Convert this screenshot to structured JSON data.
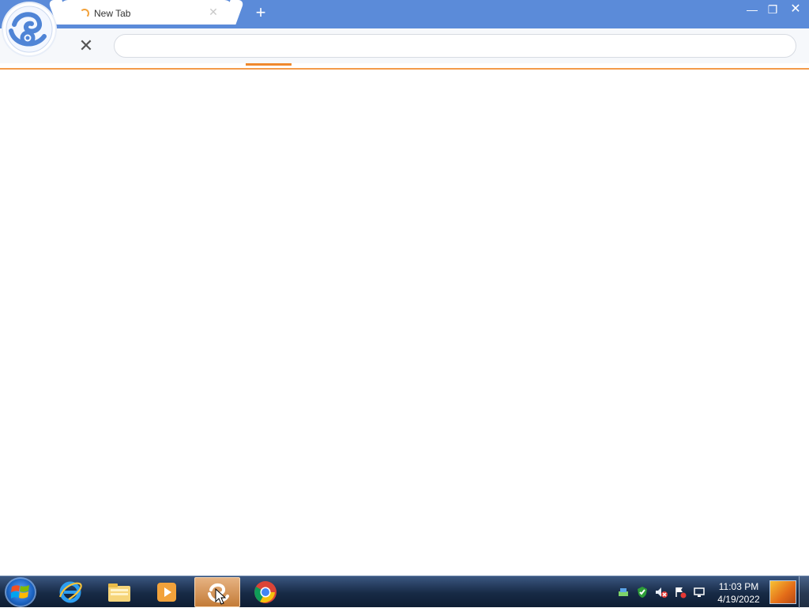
{
  "browser": {
    "tab": {
      "title": "New Tab",
      "close_icon": "close-icon",
      "loading_icon": "spinner-icon"
    },
    "new_tab_icon": "plus-icon",
    "window_controls": {
      "minimize": "minimize-icon",
      "restore": "restore-icon",
      "close": "close-icon"
    },
    "toolbar": {
      "stop_icon": "stop-icon",
      "address_value": "",
      "address_placeholder": ""
    },
    "brand_logo": "uc-browser-logo",
    "colors": {
      "titlebar": "#5b8bd9",
      "accent": "#f0882c",
      "toolbar": "#f6f8fb"
    }
  },
  "taskbar": {
    "start_icon": "windows-start-icon",
    "apps": [
      {
        "name": "Internet Explorer",
        "icon": "internet-explorer-icon",
        "active": false
      },
      {
        "name": "Windows Explorer",
        "icon": "folder-icon",
        "active": false
      },
      {
        "name": "Windows Media Player",
        "icon": "media-player-icon",
        "active": false
      },
      {
        "name": "UC Browser",
        "icon": "uc-browser-icon",
        "active": true
      },
      {
        "name": "Google Chrome",
        "icon": "chrome-icon",
        "active": false
      }
    ],
    "tray": [
      "network-icon",
      "security-icon",
      "volume-muted-icon",
      "action-center-icon",
      "display-icon"
    ],
    "clock": {
      "time": "11:03 PM",
      "date": "4/19/2022"
    }
  }
}
